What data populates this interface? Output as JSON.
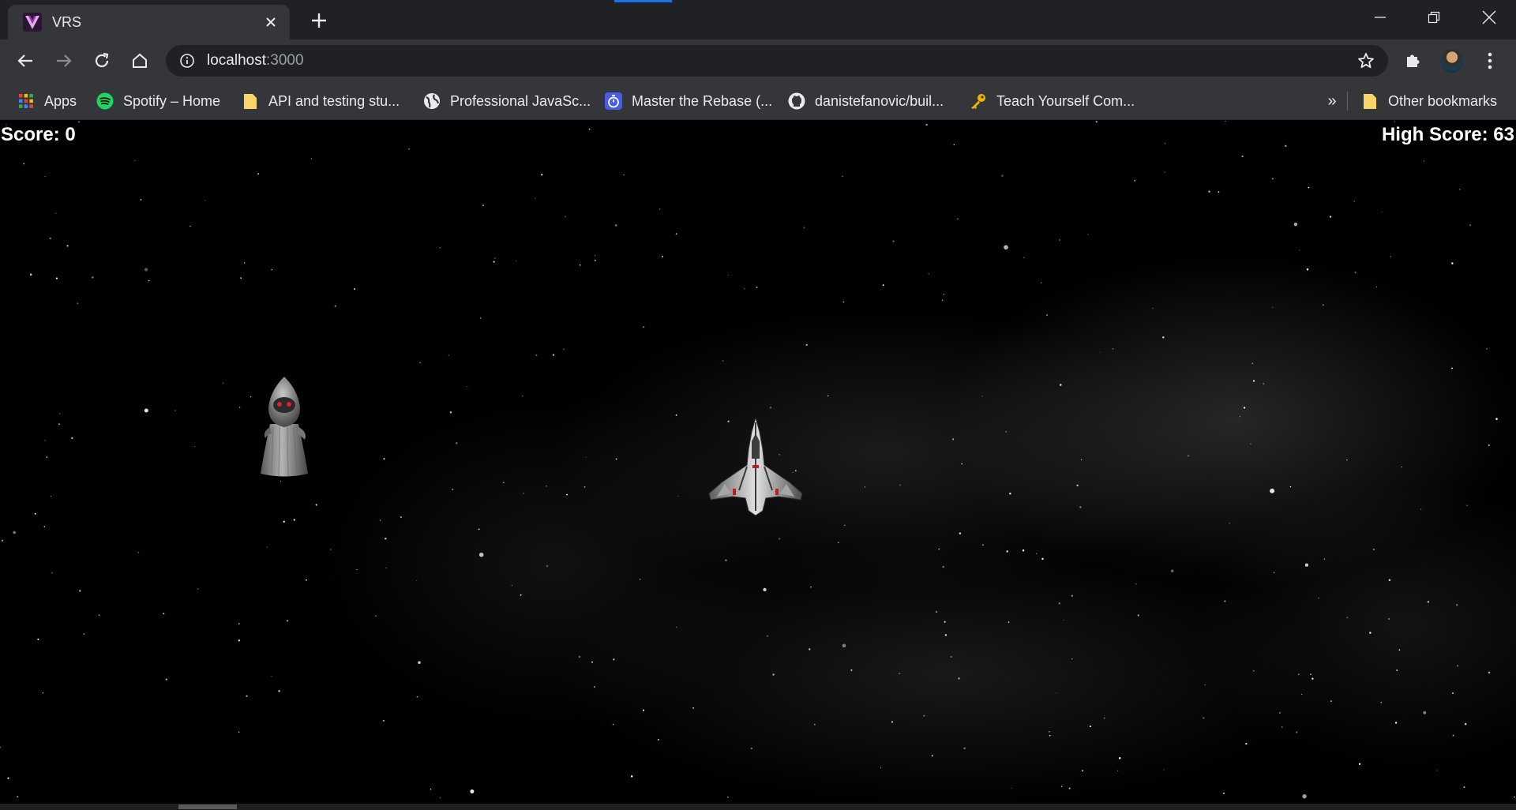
{
  "browser": {
    "tab": {
      "title": "VRS",
      "favicon": "vrs-logo-icon"
    },
    "address": {
      "host": "localhost",
      "port": ":3000"
    },
    "bookmarks": [
      {
        "label": "Apps",
        "icon": "apps-grid-icon"
      },
      {
        "label": "Spotify – Home",
        "icon": "spotify-icon"
      },
      {
        "label": "API and testing stu...",
        "icon": "folder-icon"
      },
      {
        "label": "Professional JavaSc...",
        "icon": "globe-icon"
      },
      {
        "label": "Master the Rebase (...",
        "icon": "timer-icon"
      },
      {
        "label": "danistefanovic/buil...",
        "icon": "github-icon"
      },
      {
        "label": "Teach Yourself Com...",
        "icon": "key-icon"
      }
    ],
    "more_bookmarks": "»",
    "other_bookmarks": "Other bookmarks"
  },
  "game": {
    "score_text": "Score: 0",
    "high_score_text": "High Score: 63",
    "score": 0,
    "high_score": 63
  },
  "colors": {
    "tabstrip": "#202124",
    "toolbar": "#35363a",
    "accent": "#1a73e8",
    "spotify": "#1ed760",
    "folder": "#f8d568"
  }
}
